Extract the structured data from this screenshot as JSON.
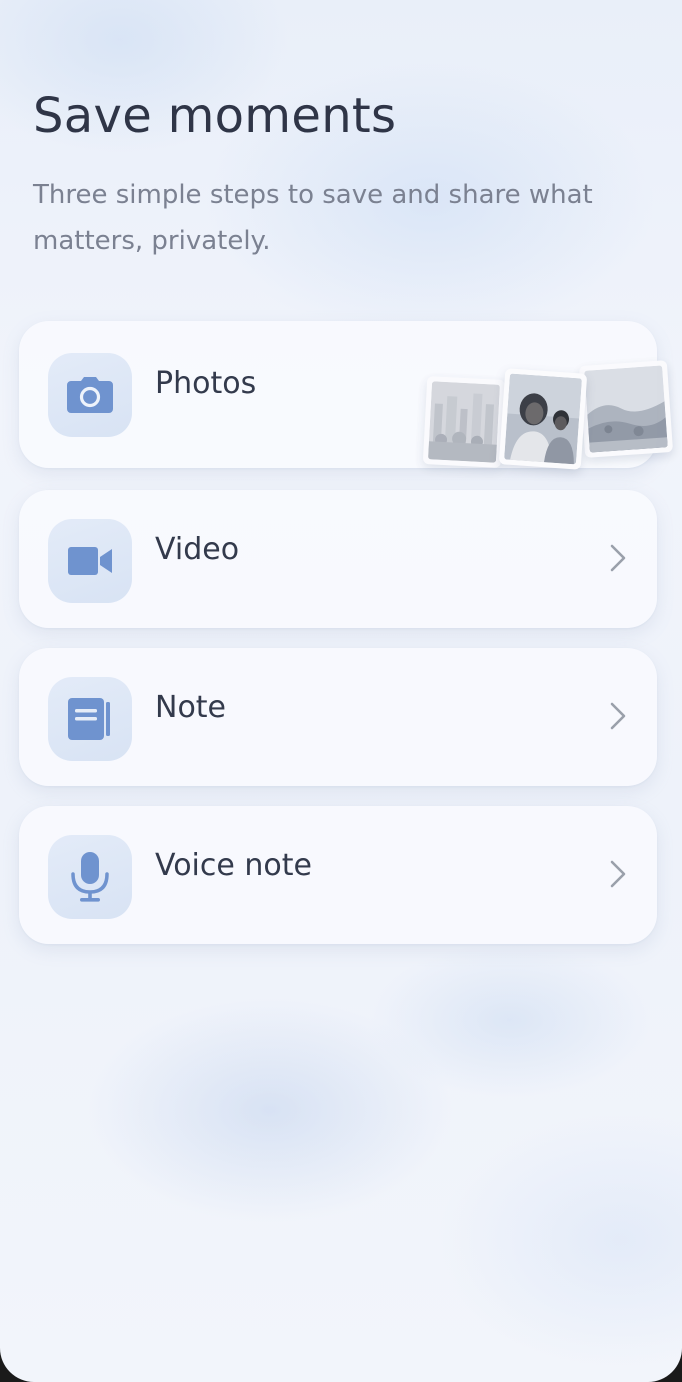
{
  "header": {
    "title": "Save moments",
    "subtitle": "Three simple steps to save and share what matters, privately."
  },
  "options": [
    {
      "label": "Photos",
      "icon": "camera-icon",
      "thumbnails": [
        "city-crowd-photo",
        "couple-portrait-photo",
        "landscape-photo"
      ]
    },
    {
      "label": "Video",
      "icon": "video-camera-icon",
      "chevron": "chevron-right-icon"
    },
    {
      "label": "Note",
      "icon": "notebook-icon",
      "chevron": "chevron-right-icon"
    },
    {
      "label": "Voice note",
      "icon": "microphone-icon",
      "chevron": "chevron-right-icon"
    }
  ],
  "colors": {
    "accent": "#6f93cf",
    "title": "#2f3547",
    "subtitle": "#7b8191",
    "card": "#f9fafe",
    "icon_tile": "#dde6f6"
  }
}
